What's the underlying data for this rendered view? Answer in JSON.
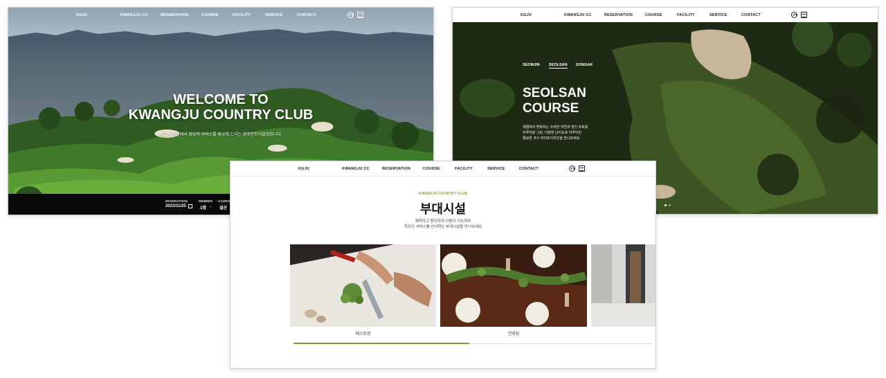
{
  "nav": {
    "logo": "KGJU",
    "items": [
      "KWANGJU CC",
      "RESERVATION",
      "COURSE",
      "FACILITY",
      "SERVICE",
      "CONTACT"
    ],
    "icons": [
      "user-icon",
      "menu-icon"
    ]
  },
  "home": {
    "title_line1": "WELCOME TO",
    "title_line2": "KWANGJU COUNTRY CLUB",
    "subtitle": "최고의 자연에서 최상의 서비스를 제공해 드리는 광주컨트리클럽입니다.",
    "reservation_label": "RESERVATION",
    "reservation_date": "2023/11/25",
    "member_label": "MEMBER",
    "member_value": "1명",
    "course_label": "COURSE",
    "course_value": "설산"
  },
  "course_page": {
    "tabs": [
      "SEOMJIN",
      "SEOLSAN",
      "DONGAK"
    ],
    "active_tab": "SEOLSAN",
    "title_line1": "SEOLSAN",
    "title_line2": "COURSE",
    "description_lines": [
      "계절따라 변화하는 수려한 자연과 멋진 조화를",
      "이루어낸 그린, 다양한 난이도로 이루어진",
      "절묘한 코스 라이트디자인을 만나보세요."
    ]
  },
  "facility_page": {
    "eyebrow": "KWANGJU COUNTRY CLUB",
    "title": "부대시설",
    "subtitle_line1": "쾌적하고 편리하게 이용이 가능하며",
    "subtitle_line2": "최상의 서비스를 선사하는 부대시설을 만나보세요",
    "cards": [
      "레스토랑",
      "연회장"
    ],
    "progress": 0.49
  },
  "colors": {
    "accent": "#8aa13a",
    "progress": "#7b9a2c",
    "dark_bar": "#0a0a0a",
    "course_bg": "#233017"
  }
}
